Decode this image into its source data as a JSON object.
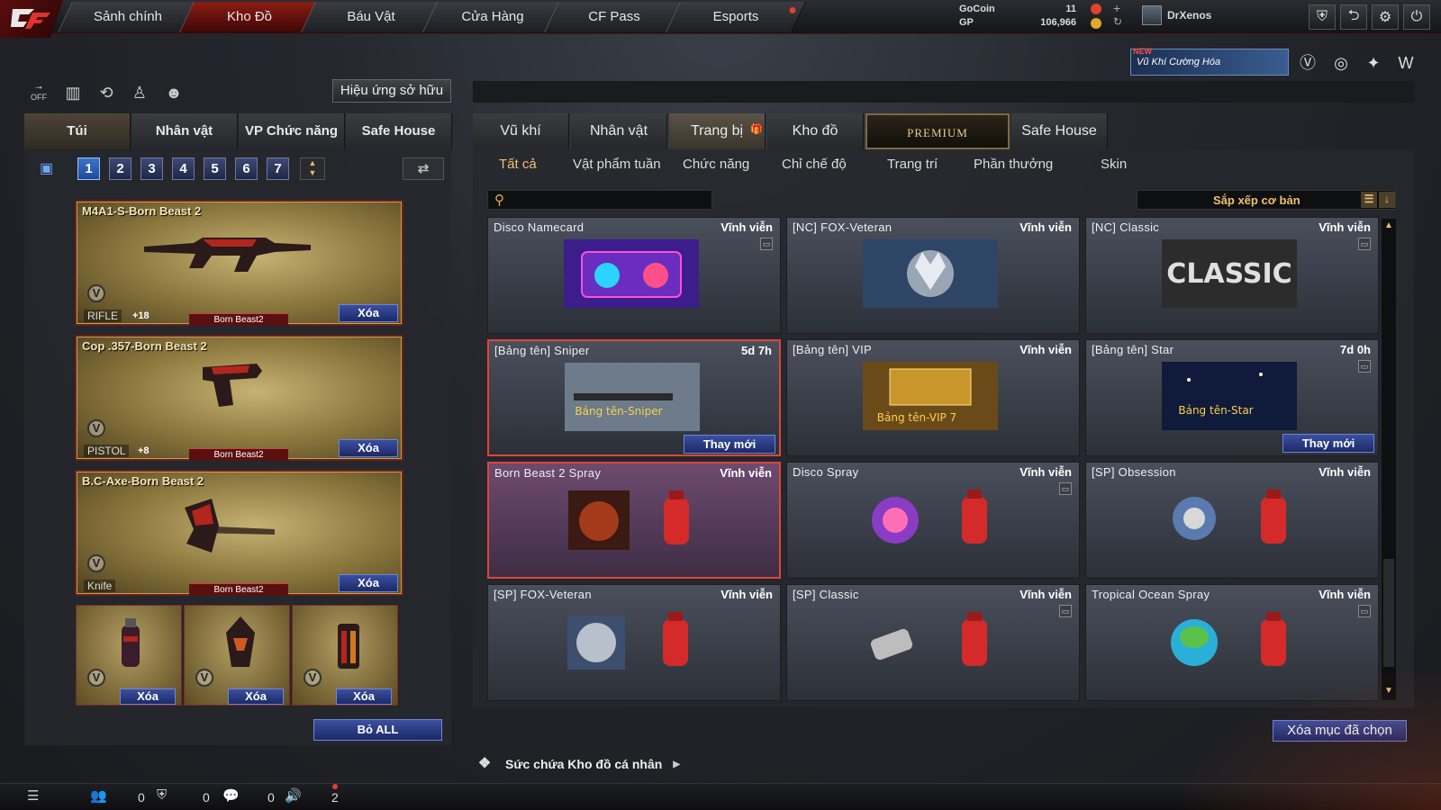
{
  "nav": {
    "tabs": [
      "Sảnh chính",
      "Kho Đồ",
      "Báu Vật",
      "Cửa Hàng",
      "CF Pass",
      "Esports"
    ],
    "active": "Kho Đồ"
  },
  "currency": {
    "gocoin_label": "GoCoin",
    "gp_label": "GP",
    "gocoin_value": "11",
    "gp_value": "106,966"
  },
  "user": {
    "name": "DrXenos"
  },
  "promo": {
    "new_badge": "NEW",
    "text": "Vũ Khí Cường Hóa"
  },
  "left_panel": {
    "toolbar": {
      "off_label": "OFF",
      "effects_button": "Hiệu ứng sở hữu"
    },
    "tabs": [
      "Túi",
      "Nhân vật",
      "VP Chức năng",
      "Safe House"
    ],
    "pages": [
      "1",
      "2",
      "3",
      "4",
      "5",
      "6",
      "7"
    ],
    "active_page": "1",
    "weapons": [
      {
        "name": "M4A1-S-Born Beast 2",
        "type": "RIFLE",
        "bonus": "+18",
        "tag": "Born Beast2",
        "delete": "Xóa"
      },
      {
        "name": "Cop .357-Born Beast 2",
        "type": "PISTOL",
        "bonus": "+8",
        "tag": "Born Beast2",
        "delete": "Xóa"
      },
      {
        "name": "B.C-Axe-Born Beast 2",
        "type": "Knife",
        "bonus": "",
        "tag": "Born Beast2",
        "delete": "Xóa"
      }
    ],
    "grenades": [
      {
        "delete": "Xóa"
      },
      {
        "delete": "Xóa"
      },
      {
        "delete": "Xóa"
      }
    ],
    "unequip_all": "Bỏ ALL",
    "badge_letter": "V"
  },
  "right_panel": {
    "tabs": [
      "Vũ khí",
      "Nhân vật",
      "Trang bị",
      "Kho đồ",
      "PREMIUM",
      "Safe House"
    ],
    "active_tab": "Trang bị",
    "subtabs": [
      "Tất cả",
      "Vật phẩm tuần",
      "Chức năng",
      "Chỉ chế độ",
      "Trang trí",
      "Phần thưởng",
      "Skin"
    ],
    "active_subtab": "Tất cả",
    "search": {
      "placeholder": ""
    },
    "sort_label": "Sắp xếp cơ bản",
    "items": [
      {
        "name": "Disco Namecard",
        "duration": "Vĩnh viễn",
        "art": "namecard-disco"
      },
      {
        "name": "[NC] FOX-Veteran",
        "duration": "Vĩnh viễn",
        "art": "namecard-fox"
      },
      {
        "name": "[NC] Classic",
        "duration": "Vĩnh viễn",
        "art": "namecard-classic",
        "art_text": "CLASSIC"
      },
      {
        "name": "[Bảng tên] Sniper",
        "duration": "5d 7h",
        "art": "nametag-sniper",
        "art_text": "Bảng tên-Sniper",
        "action": "Thay mới"
      },
      {
        "name": "[Bảng tên] VIP",
        "duration": "Vĩnh viễn",
        "art": "nametag-vip",
        "art_text": "Bảng tên-VIP 7"
      },
      {
        "name": "[Bảng tên] Star",
        "duration": "7d 0h",
        "art": "nametag-star",
        "art_text": "Bảng tên-Star",
        "action": "Thay mới"
      },
      {
        "name": "Born Beast 2  Spray",
        "duration": "Vĩnh viễn",
        "art": "spray-beast"
      },
      {
        "name": "Disco Spray",
        "duration": "Vĩnh viễn",
        "art": "spray-disco"
      },
      {
        "name": "[SP] Obsession",
        "duration": "Vĩnh viễn",
        "art": "spray-obsession"
      },
      {
        "name": "[SP] FOX-Veteran",
        "duration": "Vĩnh viễn",
        "art": "spray-fox"
      },
      {
        "name": "[SP] Classic",
        "duration": "Vĩnh viễn",
        "art": "spray-classic"
      },
      {
        "name": "Tropical Ocean Spray",
        "duration": "Vĩnh viễn",
        "art": "spray-tropical"
      }
    ],
    "delete_selected": "Xóa mục đã chọn",
    "capacity_label": "Sức chứa Kho đồ cá nhân"
  },
  "bottom_bar": {
    "counts": [
      "0",
      "0",
      "0",
      "2"
    ]
  },
  "colors": {
    "accent_red": "#8c1c14",
    "button_blue": "#1c2a66",
    "gold_text": "#f0c070"
  }
}
